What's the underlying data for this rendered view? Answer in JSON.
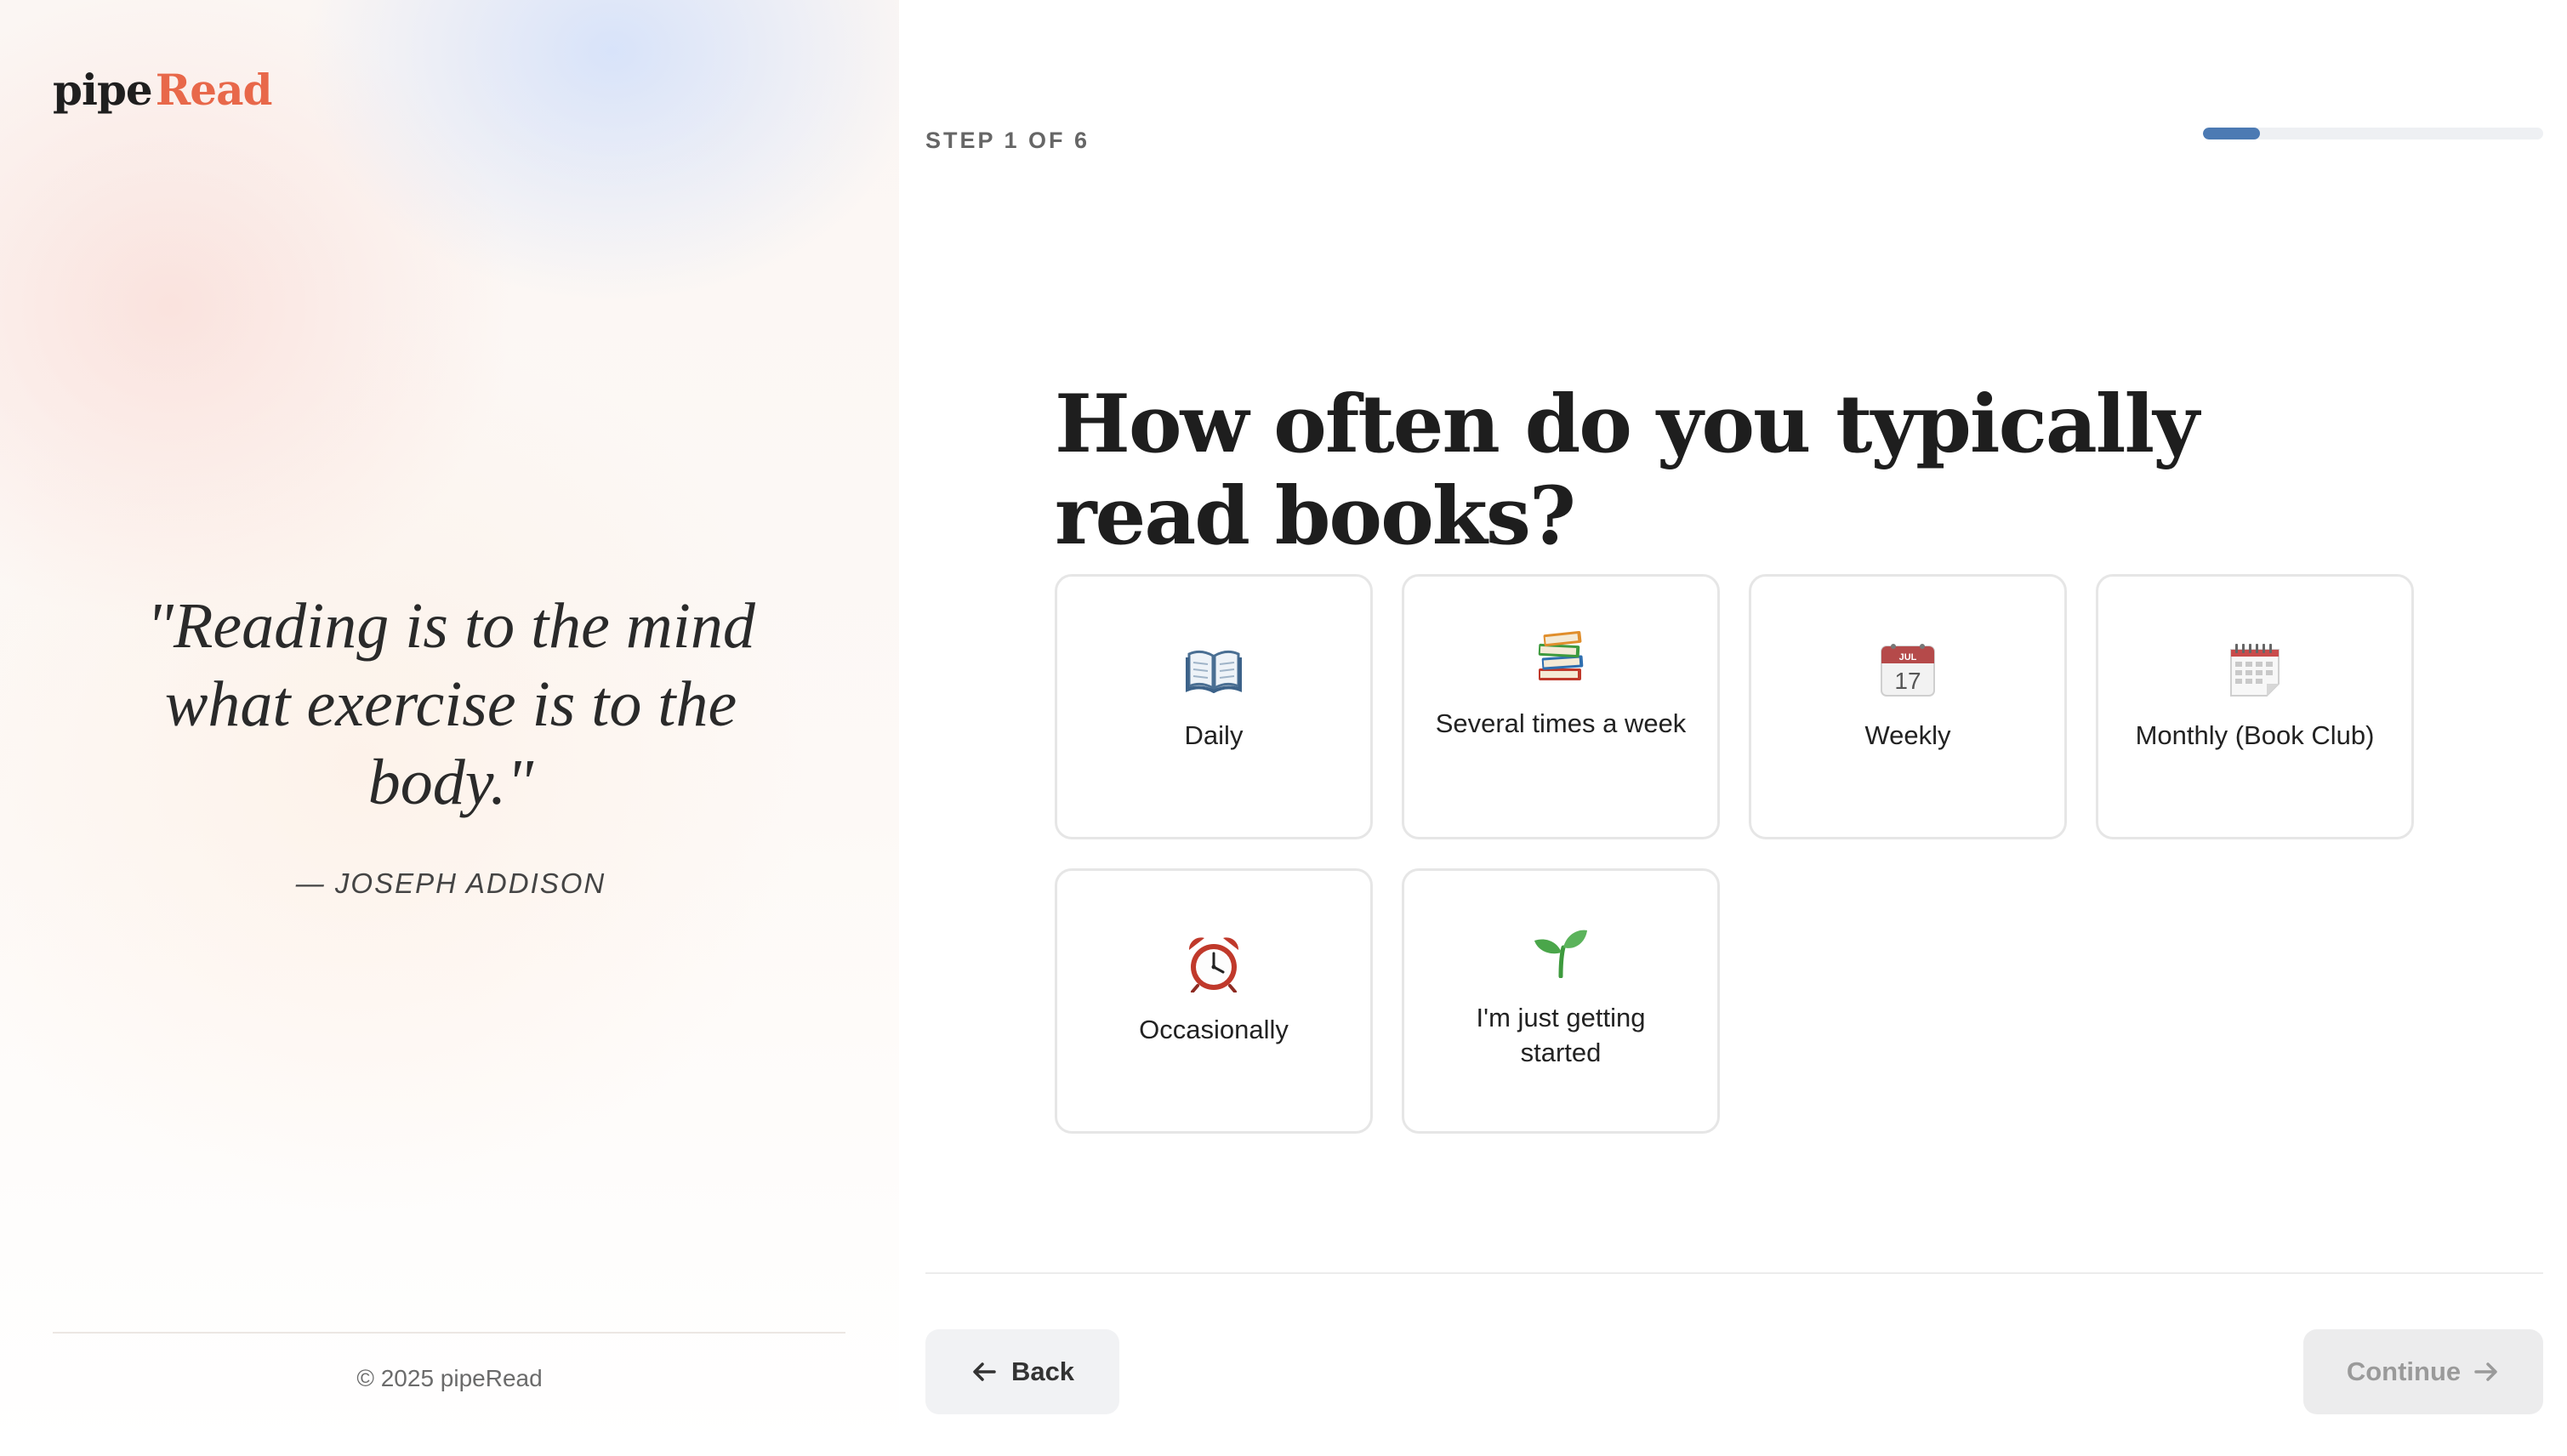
{
  "brand": {
    "part1": "pipe",
    "part2": "Read",
    "accent": "#e8684a"
  },
  "quote": {
    "text": "\"Reading is to the mind what exercise is to the body.\"",
    "author": "— JOSEPH ADDISON"
  },
  "footer": {
    "copyright": "© 2025 pipeRead"
  },
  "step": {
    "label": "STEP 1 OF 6",
    "current": 1,
    "total": 6,
    "progress": 0.1667,
    "progress_color": "#4c7ab3"
  },
  "question": "How often do you typically read books?",
  "options": [
    {
      "label": "Daily",
      "icon": "open-book-icon"
    },
    {
      "label": "Several times a week",
      "icon": "stack-of-books-icon"
    },
    {
      "label": "Weekly",
      "icon": "calendar-icon"
    },
    {
      "label": "Monthly (Book Club)",
      "icon": "spiral-calendar-icon"
    },
    {
      "label": "Occasionally",
      "icon": "alarm-clock-icon"
    },
    {
      "label": "I'm just getting started",
      "icon": "seedling-icon"
    }
  ],
  "nav": {
    "back_label": "Back",
    "continue_label": "Continue",
    "continue_disabled": true
  }
}
